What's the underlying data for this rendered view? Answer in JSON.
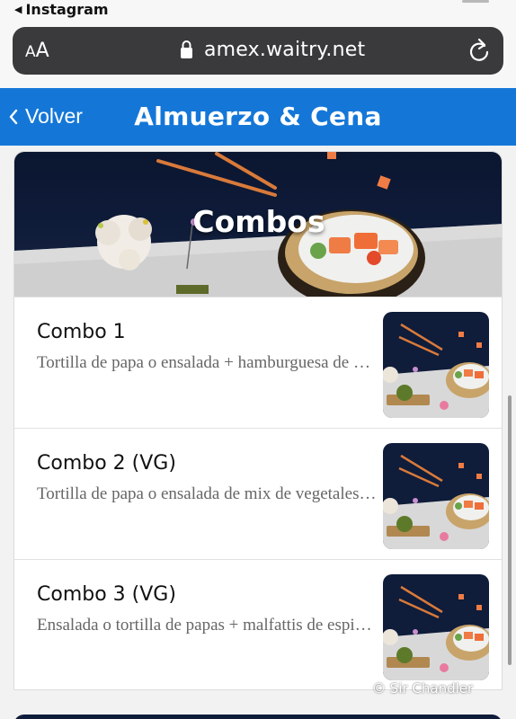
{
  "status_bar": {
    "back_app": "Instagram"
  },
  "browser": {
    "aa_small": "A",
    "aa_big": "A",
    "url": "amex.waitry.net"
  },
  "header": {
    "back_label": "Volver",
    "title": "Almuerzo & Cena"
  },
  "category": {
    "title": "Combos"
  },
  "combos": [
    {
      "name": "Combo 1",
      "description": "Tortilla de papa o ensalada + hamburguesa de pollo + bebida"
    },
    {
      "name": "Combo 2 (VG)",
      "description": "Tortilla de papa o ensalada de mix de vegetales + bebida"
    },
    {
      "name": "Combo 3 (VG)",
      "description": "Ensalada o tortilla de papas + malfattis de espinaca + bebida"
    }
  ],
  "watermark": "© Sir Chandler",
  "colors": {
    "header_blue": "#1477d8",
    "url_bar": "#3a3a3c",
    "banner_navy": "#0f1c3a"
  }
}
